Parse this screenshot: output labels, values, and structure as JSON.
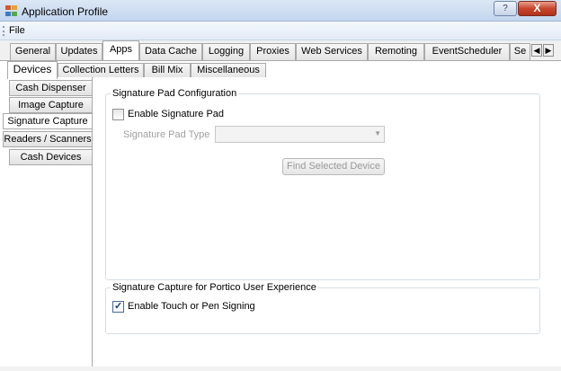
{
  "window": {
    "title": "Application Profile",
    "help_label": "?",
    "close_label": "X"
  },
  "menu": {
    "file": "File"
  },
  "tabs": [
    {
      "label": "General"
    },
    {
      "label": "Updates"
    },
    {
      "label": "Apps"
    },
    {
      "label": "Data Cache"
    },
    {
      "label": "Logging"
    },
    {
      "label": "Proxies"
    },
    {
      "label": "Web Services"
    },
    {
      "label": "Remoting"
    },
    {
      "label": "EventScheduler"
    },
    {
      "label": "Se"
    }
  ],
  "tab_scroll": {
    "left": "◀",
    "right": "▶"
  },
  "subtabs": [
    {
      "label": "Devices"
    },
    {
      "label": "Collection Letters"
    },
    {
      "label": "Bill Mix"
    },
    {
      "label": "Miscellaneous"
    }
  ],
  "left_tabs": [
    {
      "label": "Cash Dispenser"
    },
    {
      "label": "Image Capture"
    },
    {
      "label": "Signature Capture"
    },
    {
      "label": "Readers / Scanners"
    },
    {
      "label": "Cash Devices"
    }
  ],
  "signature_pad": {
    "group_title": "Signature Pad Configuration",
    "enable_label": "Enable Signature Pad",
    "enable_checked": false,
    "type_label": "Signature Pad Type",
    "type_value": "",
    "find_button": "Find Selected Device"
  },
  "portico": {
    "group_title": "Signature Capture for Portico User Experience",
    "touch_label": "Enable Touch or Pen Signing",
    "touch_checked": true,
    "checkmark": "✓"
  }
}
